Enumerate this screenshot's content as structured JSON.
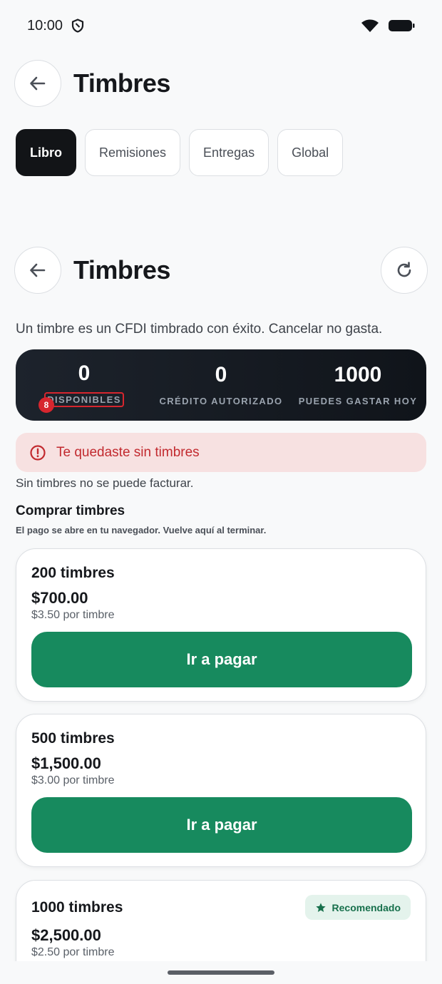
{
  "status_bar": {
    "time": "10:00"
  },
  "header": {
    "title": "Timbres"
  },
  "tabs": [
    {
      "label": "Libro",
      "active": true
    },
    {
      "label": "Remisiones",
      "active": false
    },
    {
      "label": "Entregas",
      "active": false
    },
    {
      "label": "Global",
      "active": false
    }
  ],
  "header2": {
    "title": "Timbres"
  },
  "intro": "Un timbre es un CFDI timbrado con éxito. Cancelar no gasta.",
  "stats": {
    "badge": "8",
    "items": [
      {
        "value": "0",
        "label": "DISPONIBLES"
      },
      {
        "value": "0",
        "label": "CRÉDITO AUTORIZADO"
      },
      {
        "value": "1000",
        "label": "PUEDES GASTAR HOY"
      }
    ]
  },
  "alert": {
    "text": "Te quedaste sin timbres"
  },
  "note": "Sin timbres no se puede facturar.",
  "purchase": {
    "title": "Comprar timbres",
    "subtitle": "El pago se abre en tu navegador. Vuelve aquí al terminar.",
    "packages": [
      {
        "name": "200 timbres",
        "price": "$700.00",
        "unit": "$3.50 por timbre",
        "button": "Ir a pagar"
      },
      {
        "name": "500 timbres",
        "price": "$1,500.00",
        "unit": "$3.00 por timbre",
        "button": "Ir a pagar"
      },
      {
        "name": "1000 timbres",
        "price": "$2,500.00",
        "unit": "$2.50 por timbre",
        "badge": "Recomendado"
      }
    ]
  },
  "colors": {
    "accent_green": "#178a5e",
    "alert_red": "#c22a2f",
    "dark_card": "#121417"
  }
}
